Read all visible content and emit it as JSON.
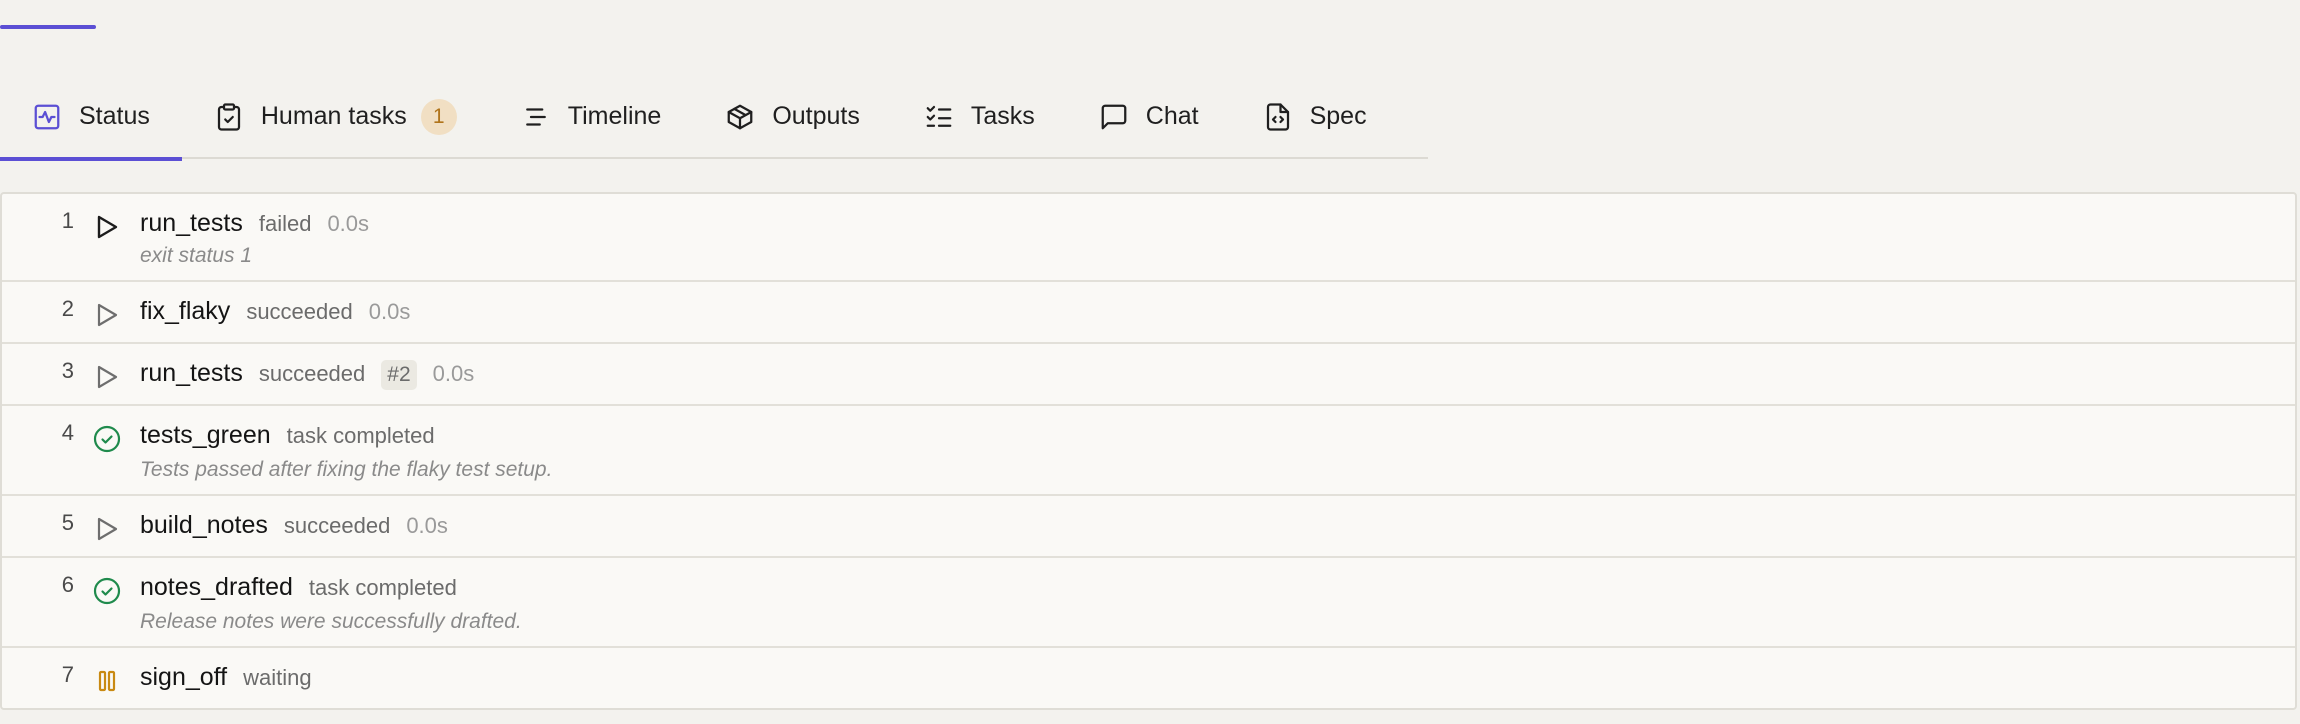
{
  "tabs": [
    {
      "label": "Status",
      "icon": "activity-icon",
      "active": true
    },
    {
      "label": "Human tasks",
      "icon": "clipboard-check-icon",
      "badge": "1"
    },
    {
      "label": "Timeline",
      "icon": "align-left-icon"
    },
    {
      "label": "Outputs",
      "icon": "box-icon"
    },
    {
      "label": "Tasks",
      "icon": "list-checks-icon"
    },
    {
      "label": "Chat",
      "icon": "message-square-icon"
    },
    {
      "label": "Spec",
      "icon": "file-code-icon"
    }
  ],
  "steps": [
    {
      "num": "1",
      "name": "run_tests",
      "state": "failed",
      "duration": "0.0s",
      "note": "exit status 1",
      "icon": "play-icon"
    },
    {
      "num": "2",
      "name": "fix_flaky",
      "state": "succeeded",
      "duration": "0.0s",
      "icon": "play-icon"
    },
    {
      "num": "3",
      "name": "run_tests",
      "state": "succeeded",
      "tag": "#2",
      "duration": "0.0s",
      "icon": "play-icon"
    },
    {
      "num": "4",
      "name": "tests_green",
      "state": "task completed",
      "note": "Tests passed after fixing the flaky test setup.",
      "icon": "check-circle-icon"
    },
    {
      "num": "5",
      "name": "build_notes",
      "state": "succeeded",
      "duration": "0.0s",
      "icon": "play-icon"
    },
    {
      "num": "6",
      "name": "notes_drafted",
      "state": "task completed",
      "note": "Release notes were successfully drafted.",
      "icon": "check-circle-icon"
    },
    {
      "num": "7",
      "name": "sign_off",
      "state": "waiting",
      "icon": "pause-icon"
    }
  ],
  "colors": {
    "accent": "#5b4fd4",
    "success": "#1f8a4c",
    "waiting": "#c98a12",
    "badge_bg": "#f1dfc3"
  }
}
